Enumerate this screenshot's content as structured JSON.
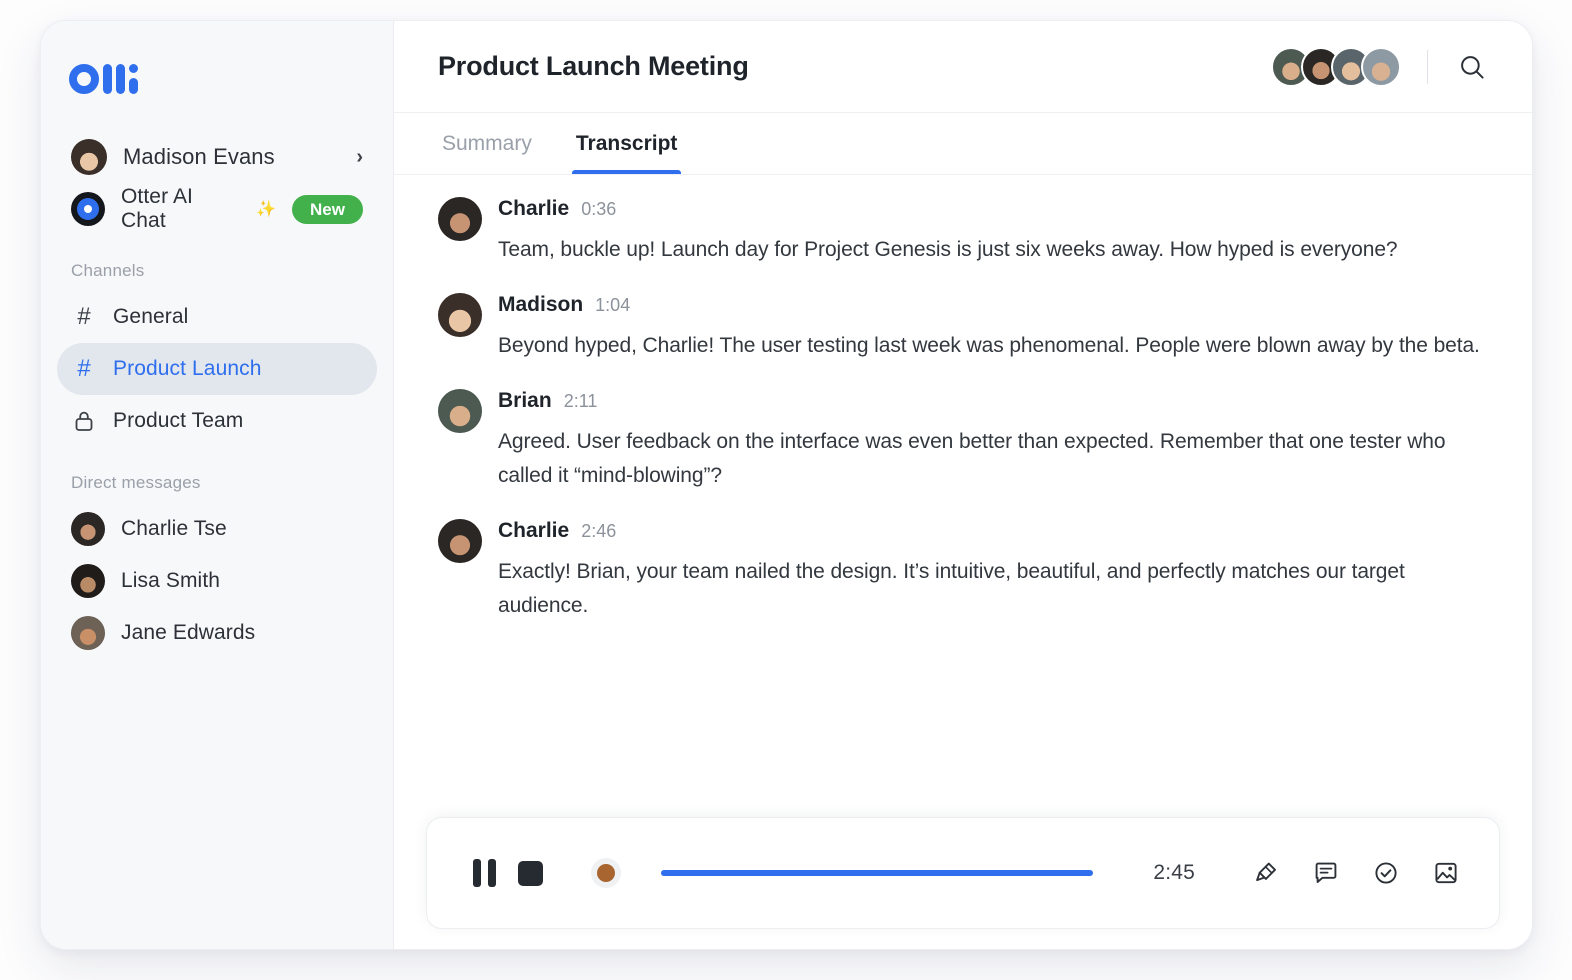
{
  "sidebar": {
    "logo_name": "otter-logo",
    "user": {
      "name": "Madison Evans",
      "chevron": "›"
    },
    "ai_chat": {
      "label": "Otter AI Chat",
      "sparkle": "✨",
      "badge": "New"
    },
    "channels_title": "Channels",
    "channels": [
      {
        "label": "General",
        "icon": "hash-icon",
        "active": false
      },
      {
        "label": "Product Launch",
        "icon": "hash-icon",
        "active": true
      },
      {
        "label": "Product Team",
        "icon": "lock-icon",
        "active": false
      }
    ],
    "dm_title": "Direct messages",
    "dms": [
      {
        "name": "Charlie Tse"
      },
      {
        "name": "Lisa Smith"
      },
      {
        "name": "Jane Edwards"
      }
    ]
  },
  "header": {
    "title": "Product Launch Meeting",
    "participant_count": 4,
    "search_icon": "search-icon"
  },
  "tabs": [
    {
      "label": "Summary",
      "active": false
    },
    {
      "label": "Transcript",
      "active": true
    }
  ],
  "transcript": [
    {
      "speaker": "Charlie",
      "time": "0:36",
      "text": "Team, buckle up! Launch day for Project Genesis is just six weeks away. How hyped is everyone?"
    },
    {
      "speaker": "Madison",
      "time": "1:04",
      "text": "Beyond hyped, Charlie! The user testing last week was phenomenal. People were blown away by the beta."
    },
    {
      "speaker": "Brian",
      "time": "2:11",
      "text": "Agreed. User feedback on the interface was even better than expected. Remember that one tester who called it “mind-blowing”?"
    },
    {
      "speaker": "Charlie",
      "time": "2:46",
      "text": "Exactly! Brian, your team nailed the design. It’s intuitive, beautiful, and perfectly matches our target audience."
    }
  ],
  "player": {
    "pause_label": "pause-button",
    "stop_label": "stop-button",
    "time": "2:45",
    "progress_percent": 100,
    "actions": [
      {
        "icon": "highlighter-icon"
      },
      {
        "icon": "comment-icon"
      },
      {
        "icon": "action-item-icon"
      },
      {
        "icon": "image-icon"
      }
    ]
  },
  "colors": {
    "accent": "#2f6fed",
    "badge_green": "#43b14b",
    "sidebar_bg": "#f7f8fa",
    "active_pill": "#e2e6ed",
    "text_primary": "#1f242b",
    "text_muted": "#9aa0a9"
  }
}
